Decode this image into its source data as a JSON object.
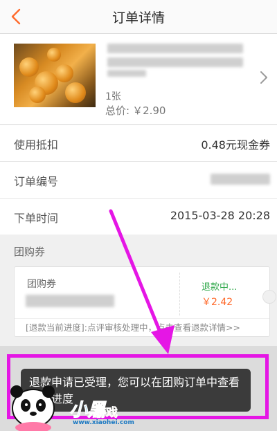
{
  "header": {
    "title": "订单详情"
  },
  "product": {
    "quantity": "1张",
    "price_label": "总价:",
    "price": "￥2.90"
  },
  "rows": [
    {
      "label": "使用抵扣",
      "value": "0.48元现金券"
    },
    {
      "label": "订单编号",
      "value": ""
    },
    {
      "label": "下单时间",
      "value": "2015-03-28 20:28"
    }
  ],
  "coupon_section": {
    "heading": "团购券",
    "coupon_name": "团购券",
    "status": "退款中...",
    "amount": "￥2.42",
    "progress_text": "[退款当前进度]:点评审核处理中，点击查看退款详情>>"
  },
  "toast": {
    "message": "退款申请已受理，您可以在团购订单中查看退款进度"
  },
  "watermark": {
    "brand": "小黑",
    "brand2": "游戏",
    "url": "www.xiaohei.com"
  },
  "colors": {
    "accent": "#ff6a2b",
    "status_green": "#2fa84a",
    "highlight": "#e516e5"
  },
  "icons": {
    "back": "chevron-left-icon",
    "detail": "chevron-right-icon"
  }
}
